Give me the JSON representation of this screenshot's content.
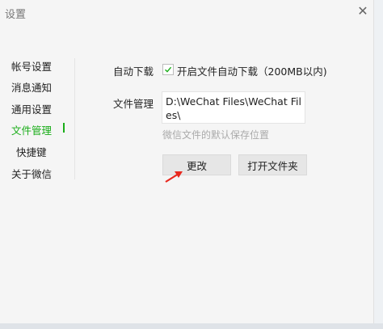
{
  "window": {
    "title": "设置",
    "close_glyph": "✕"
  },
  "sidebar": {
    "items": [
      {
        "label": "帐号设置"
      },
      {
        "label": "消息通知"
      },
      {
        "label": "通用设置"
      },
      {
        "label": "文件管理",
        "active": true
      },
      {
        "label": "快捷键"
      },
      {
        "label": "关于微信"
      }
    ]
  },
  "settings": {
    "auto_download": {
      "label": "自动下载",
      "checkbox_label": "开启文件自动下载（200MB以内)",
      "checked": true
    },
    "file_manage": {
      "label": "文件管理",
      "path": "D:\\WeChat Files\\WeChat Files\\",
      "hint": "微信文件的默认保存位置",
      "change_button": "更改",
      "open_folder_button": "打开文件夹"
    }
  },
  "colors": {
    "accent": "#1aad19",
    "arrow": "#e8281e"
  },
  "icons": {
    "check": "check-icon",
    "close": "close-icon",
    "annotation_arrow": "arrow-icon"
  }
}
